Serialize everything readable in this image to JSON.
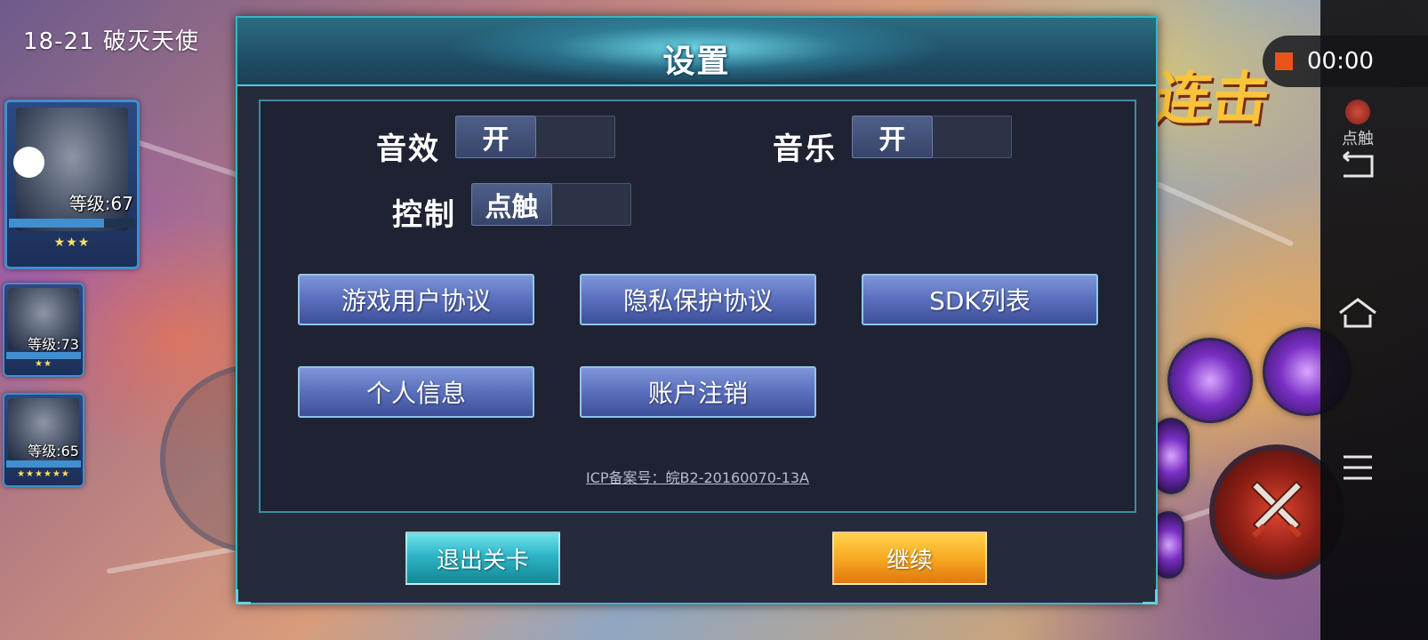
{
  "stage": {
    "label": "18-21  破灭天使",
    "combo_text": "连击"
  },
  "team": [
    {
      "level": "等级:67",
      "hp_fraction": 0.75,
      "stars": "★★★"
    },
    {
      "level": "等级:73",
      "hp_fraction": 1.0,
      "stars": "★★"
    },
    {
      "level": "等级:65",
      "hp_fraction": 1.0,
      "stars": "★★★★★★"
    }
  ],
  "recorder": {
    "time": "00:00",
    "tap_label": "点触"
  },
  "settings": {
    "title": "设置",
    "sound": {
      "label": "音效",
      "value": "开"
    },
    "music": {
      "label": "音乐",
      "value": "开"
    },
    "control": {
      "label": "控制",
      "value": "点触"
    },
    "buttons": {
      "user_agreement": "游戏用户协议",
      "privacy": "隐私保护协议",
      "sdk_list": "SDK列表",
      "personal_info": "个人信息",
      "account_cancel": "账户注销"
    },
    "icp": "ICP备案号：皖B2-20160070-13A",
    "exit": "退出关卡",
    "continue": "继续"
  },
  "colors": {
    "panel_bg": "#262b3c",
    "panel_border": "#3bb5c8",
    "menu_button": "#5a6fbd",
    "exit_button": "#2eb4c6",
    "continue_button": "#f7a520",
    "record_icon": "#e8531e"
  },
  "icons": {
    "system_bar": [
      "back-icon",
      "home-icon",
      "menu-icon"
    ],
    "record": "stop-record-icon"
  }
}
